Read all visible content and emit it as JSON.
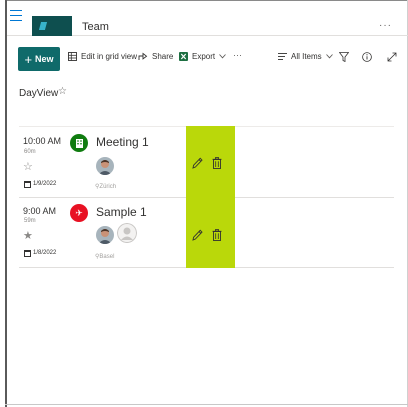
{
  "header": {
    "site_title": "Team",
    "more": "···",
    "colors": {
      "logo_bg": "#0e4f4f",
      "logo_mark": "#37b3c9",
      "menu": "#0078d4"
    }
  },
  "commandbar": {
    "new_label": "New",
    "edit_grid_label": "Edit in grid view",
    "share_label": "Share",
    "export_label": "Export",
    "more": "···",
    "view_label": "All Items",
    "icons": [
      "plus-icon",
      "grid-icon",
      "share-icon",
      "excel-icon",
      "chevron-down-icon",
      "view-options-icon",
      "filter-icon",
      "info-icon",
      "expand-icon"
    ],
    "colors": {
      "new_button": "#0f6a6a",
      "excel": "#1d6f42"
    }
  },
  "page": {
    "title": "DayView",
    "favorite_icon": "star-outline-icon"
  },
  "rows": [
    {
      "time": "10:00 AM",
      "duration": "60m",
      "favorite": "☆",
      "date": "1/9/2022",
      "title": "Meeting 1",
      "location": "Zürich",
      "category_icon": "building-icon",
      "category_color": "#107c10",
      "attendees": [
        "person-photo"
      ]
    },
    {
      "time": "9:00 AM",
      "duration": "59m",
      "favorite": "★",
      "date": "1/8/2022",
      "title": "Sample 1",
      "location": "Basel",
      "category_icon": "airplane-icon",
      "category_color": "#e81123",
      "attendees": [
        "person-photo",
        "person-placeholder"
      ]
    }
  ],
  "actions": {
    "edit_icon": "pencil-icon",
    "delete_icon": "trash-icon",
    "highlight_color": "#bad80a"
  }
}
